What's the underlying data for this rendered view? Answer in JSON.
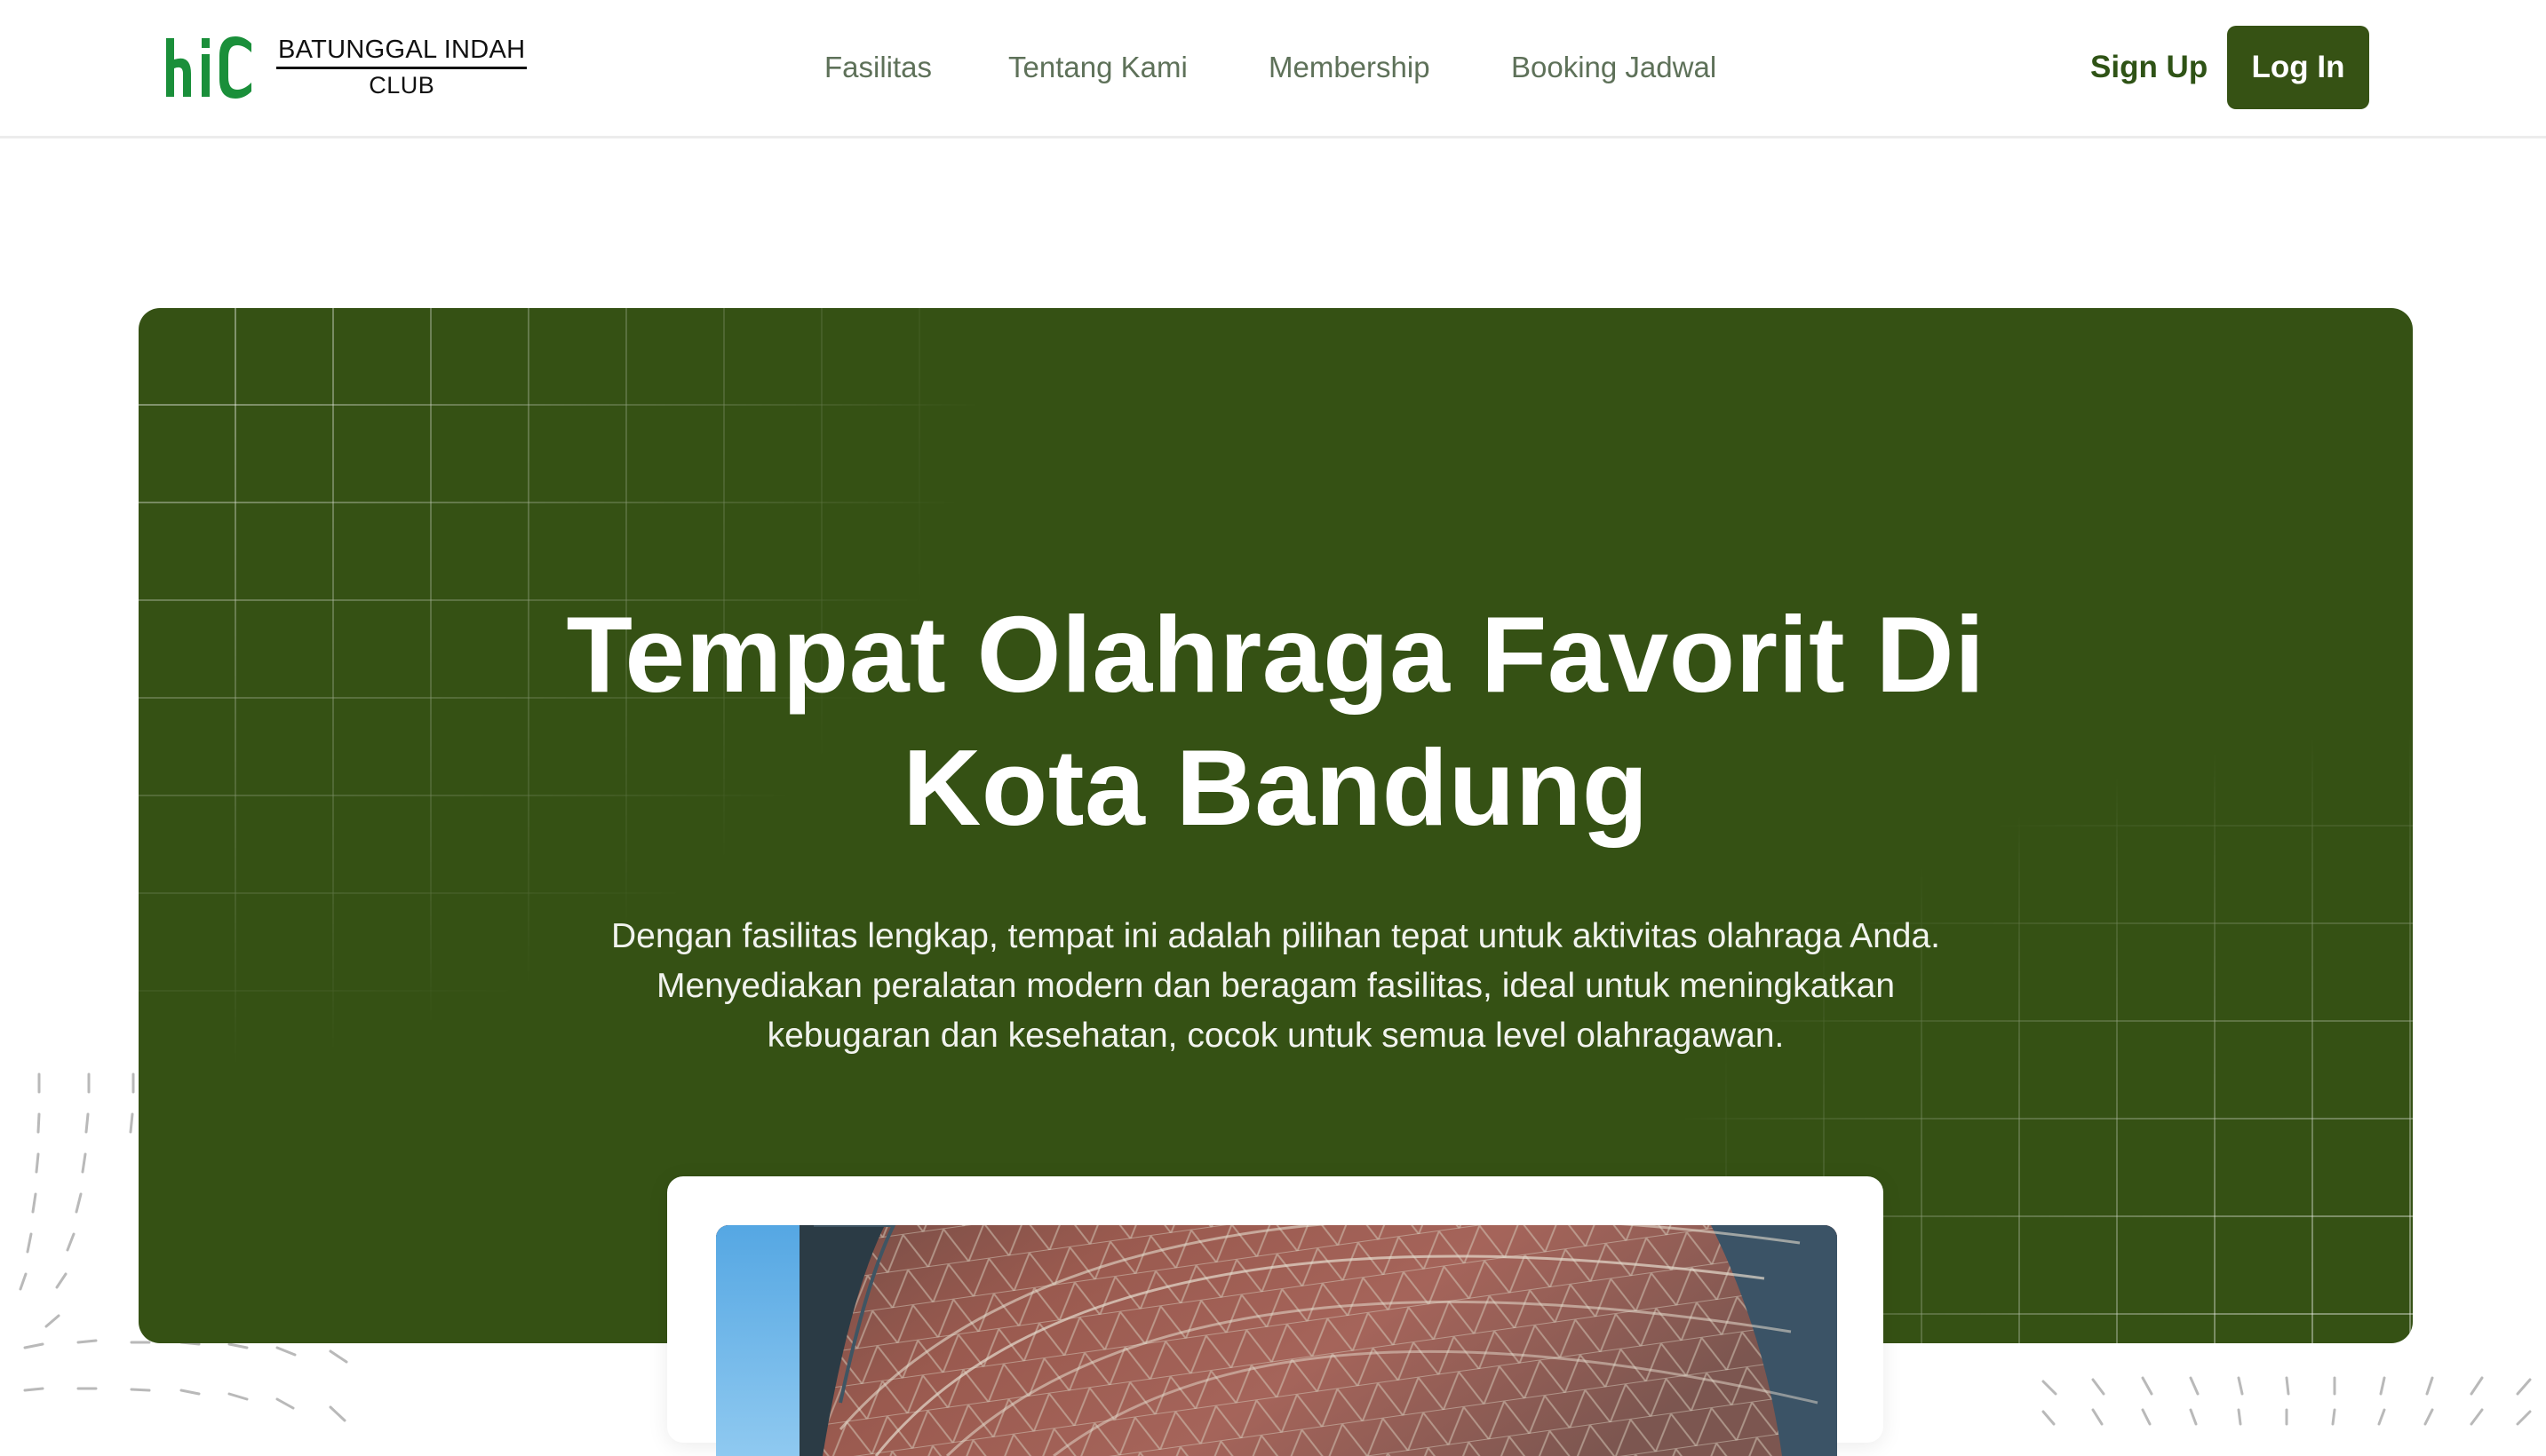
{
  "brand": {
    "name_line1": "BATUNGGAL INDAH",
    "name_line2": "CLUB",
    "logo_glyph": "biC",
    "logo_color": "#1a8f3a"
  },
  "nav": {
    "items": [
      {
        "label": "Fasilitas"
      },
      {
        "label": "Tentang Kami"
      },
      {
        "label": "Membership"
      },
      {
        "label": "Booking Jadwal"
      }
    ],
    "signup_label": "Sign Up",
    "login_label": "Log In"
  },
  "hero": {
    "title_line1": "Tempat Olahraga Favorit Di",
    "title_line2": "Kota Bandung",
    "subtitle_line1": "Dengan fasilitas lengkap, tempat ini adalah pilihan tepat untuk aktivitas olahraga Anda.",
    "subtitle_line2": "Menyediakan peralatan modern dan beragam fasilitas, ideal untuk meningkatkan",
    "subtitle_line3": "kebugaran dan kesehatan, cocok untuk semua level olahragawan.",
    "background_color": "#355114"
  },
  "preview": {
    "image_icon": "facility-roof-photo"
  },
  "colors": {
    "accent": "#365214",
    "nav_text": "#5e7159",
    "signup_text": "#2f5316"
  }
}
